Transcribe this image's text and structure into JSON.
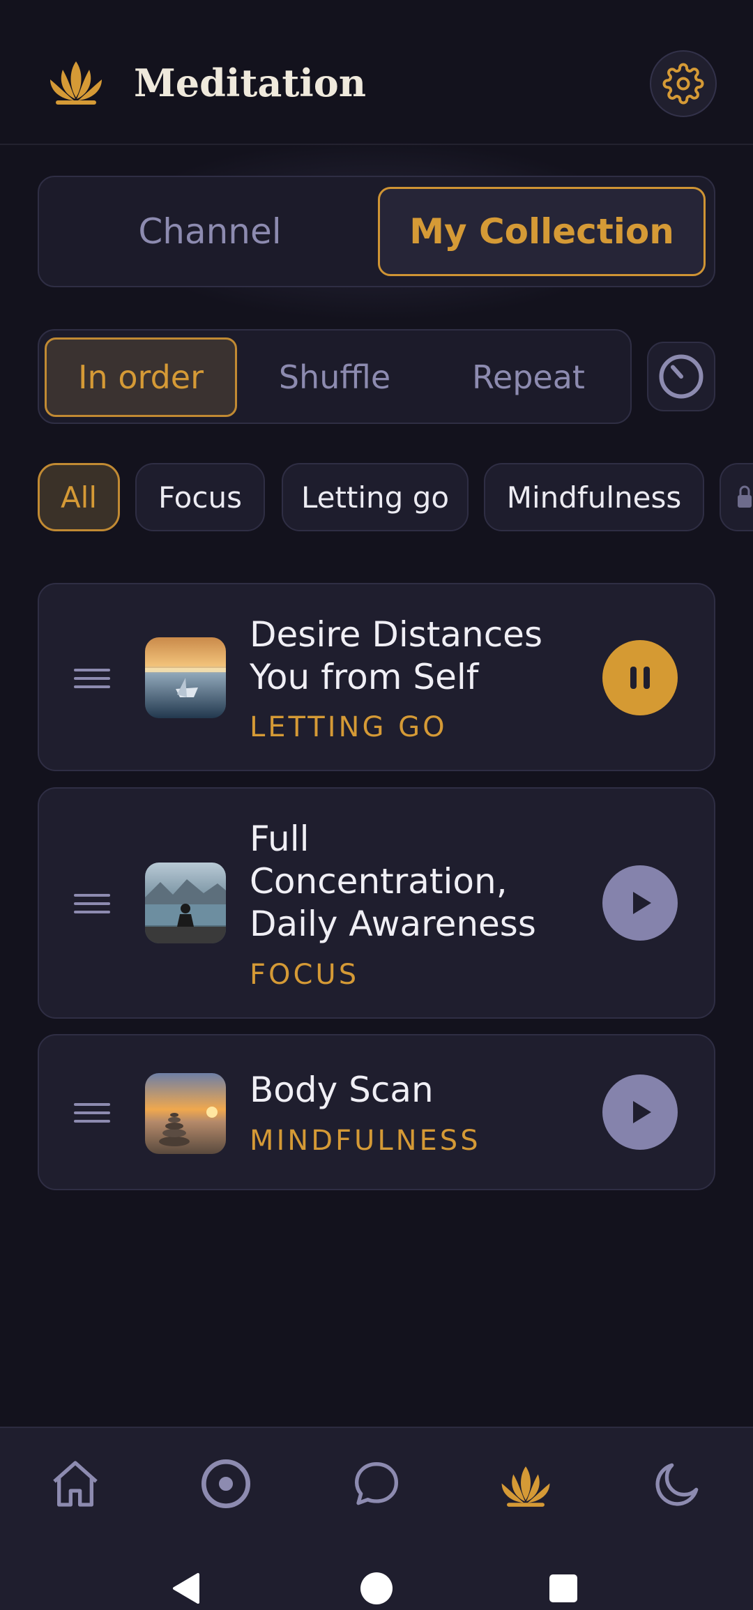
{
  "header": {
    "title": "Meditation",
    "logo_icon": "lotus-icon",
    "settings_icon": "gear-icon"
  },
  "top_tabs": [
    {
      "label": "Channel",
      "active": false
    },
    {
      "label": "My Collection",
      "active": true
    }
  ],
  "modes": [
    {
      "label": "In order",
      "active": true
    },
    {
      "label": "Shuffle",
      "active": false
    },
    {
      "label": "Repeat",
      "active": false
    }
  ],
  "timer_icon": "timer-icon",
  "filters": [
    {
      "label": "All",
      "active": true
    },
    {
      "label": "Focus",
      "active": false
    },
    {
      "label": "Letting go",
      "active": false
    },
    {
      "label": "Mindfulness",
      "active": false
    }
  ],
  "tracks": [
    {
      "title": "Desire Distances You from Self",
      "category": "LETTING GO",
      "state": "playing",
      "thumb": "paper-boat-sunset"
    },
    {
      "title": "Full Concentration, Daily Awareness",
      "category": "FOCUS",
      "state": "paused",
      "thumb": "meditating-by-lake"
    },
    {
      "title": "Body Scan",
      "category": "MINDFULNESS",
      "state": "paused",
      "thumb": "stone-cairn-beach"
    }
  ],
  "bottom_nav": [
    {
      "icon": "home-icon",
      "active": false
    },
    {
      "icon": "target-icon",
      "active": false
    },
    {
      "icon": "chat-bubble-icon",
      "active": false
    },
    {
      "icon": "lotus-icon",
      "active": true
    },
    {
      "icon": "moon-icon",
      "active": false
    }
  ],
  "colors": {
    "accent": "#d59a36",
    "muted": "#8d8bb0",
    "background": "#13121d",
    "card": "#1f1e2e"
  }
}
